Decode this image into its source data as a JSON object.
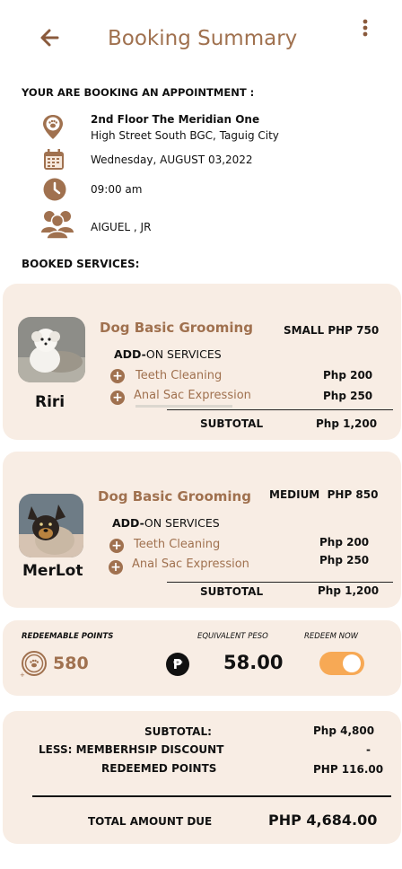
{
  "header": {
    "title": "Booking Summary",
    "back_icon": "arrow-left-icon",
    "menu_icon": "more-vertical-icon"
  },
  "appointment": {
    "heading": "YOUR ARE BOOKING AN APPOINTMENT :",
    "location_line1": "2nd Floor The Meridian One",
    "location_line2": "High Street South BGC, Taguig City",
    "date": "Wednesday, AUGUST 03,2022",
    "time": "09:00 am",
    "groomer": "AIGUEL , JR"
  },
  "booked_services_heading": "BOOKED SERVICES:",
  "pets": [
    {
      "name": "Riri",
      "service": "Dog Basic Grooming",
      "size_price": "SMALL PHP 750",
      "addon_heading_bold": "ADD-",
      "addon_heading_rest": "ON SERVICES",
      "addons": [
        {
          "label": "Teeth Cleaning",
          "price": "Php 200"
        },
        {
          "label": "Anal Sac Expression",
          "price": "Php 250"
        }
      ],
      "subtotal_label": "SUBTOTAL",
      "subtotal_value": "Php 1,200"
    },
    {
      "name": "MerLot",
      "service": "Dog Basic Grooming",
      "size_price": "MEDIUM  PHP 850",
      "addon_heading_bold": "ADD-",
      "addon_heading_rest": "ON SERVICES",
      "addons": [
        {
          "label": "Teeth Cleaning",
          "price": "Php 200"
        },
        {
          "label": "Anal Sac Expression",
          "price": "Php 250"
        }
      ],
      "subtotal_label": "SUBTOTAL",
      "subtotal_value": "Php 1,200"
    }
  ],
  "points": {
    "redeemable_label": "REDEEMABLE POINTS",
    "points_value": "580",
    "equivalent_label": "EQUIVALENT PESO",
    "peso_symbol": "₱",
    "equivalent_value": "58.00",
    "redeem_label": "REDEEM NOW",
    "redeem_on": true
  },
  "summary": {
    "subtotal_label": "SUBTOTAL:",
    "subtotal_value": "Php 4,800",
    "discount_label": "LESS: MEMBERHSIP DISCOUNT",
    "discount_value": "-",
    "redeemed_label": "REDEEMED POINTS",
    "redeemed_value": "PHP 116.00",
    "total_label": "TOTAL AMOUNT DUE",
    "total_value": "PHP 4,684.00"
  },
  "colors": {
    "accent": "#a0714f",
    "card_bg": "#f8ede4",
    "toggle": "#f7a955"
  }
}
